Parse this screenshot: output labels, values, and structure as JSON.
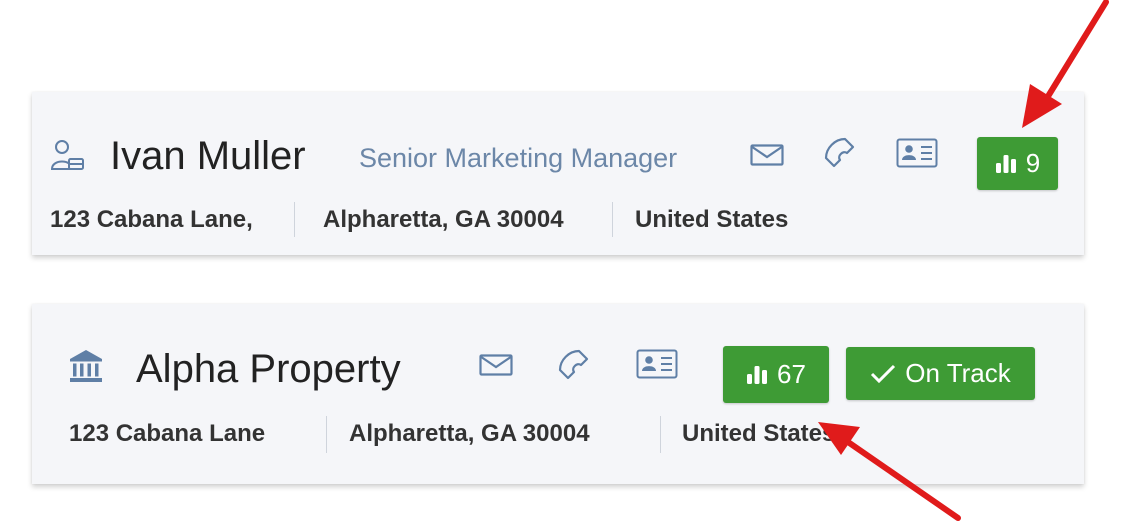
{
  "contact": {
    "name": "Ivan Muller",
    "title": "Senior Marketing Manager",
    "address": {
      "street": "123 Cabana Lane,",
      "city_state_zip": "Alpharetta, GA 30004",
      "country": "United States"
    },
    "badge_count": "9",
    "icons": [
      "person-icon",
      "email-icon",
      "phone-icon",
      "contact-card-icon",
      "bar-chart-icon"
    ]
  },
  "company": {
    "name": "Alpha Property",
    "address": {
      "street": "123 Cabana Lane",
      "city_state_zip": "Alpharetta, GA 30004",
      "country": "United States"
    },
    "badge_count": "67",
    "status_label": "On Track",
    "icons": [
      "bank-icon",
      "email-icon",
      "phone-icon",
      "contact-card-icon",
      "bar-chart-icon",
      "checkmark-icon"
    ]
  },
  "colors": {
    "badge_green": "#3e9b35",
    "title_blue": "#6c87a8",
    "icon_blue": "#5f7fa6",
    "annotation_arrow": "#e01b1b",
    "card_background": "#f5f6f9"
  }
}
